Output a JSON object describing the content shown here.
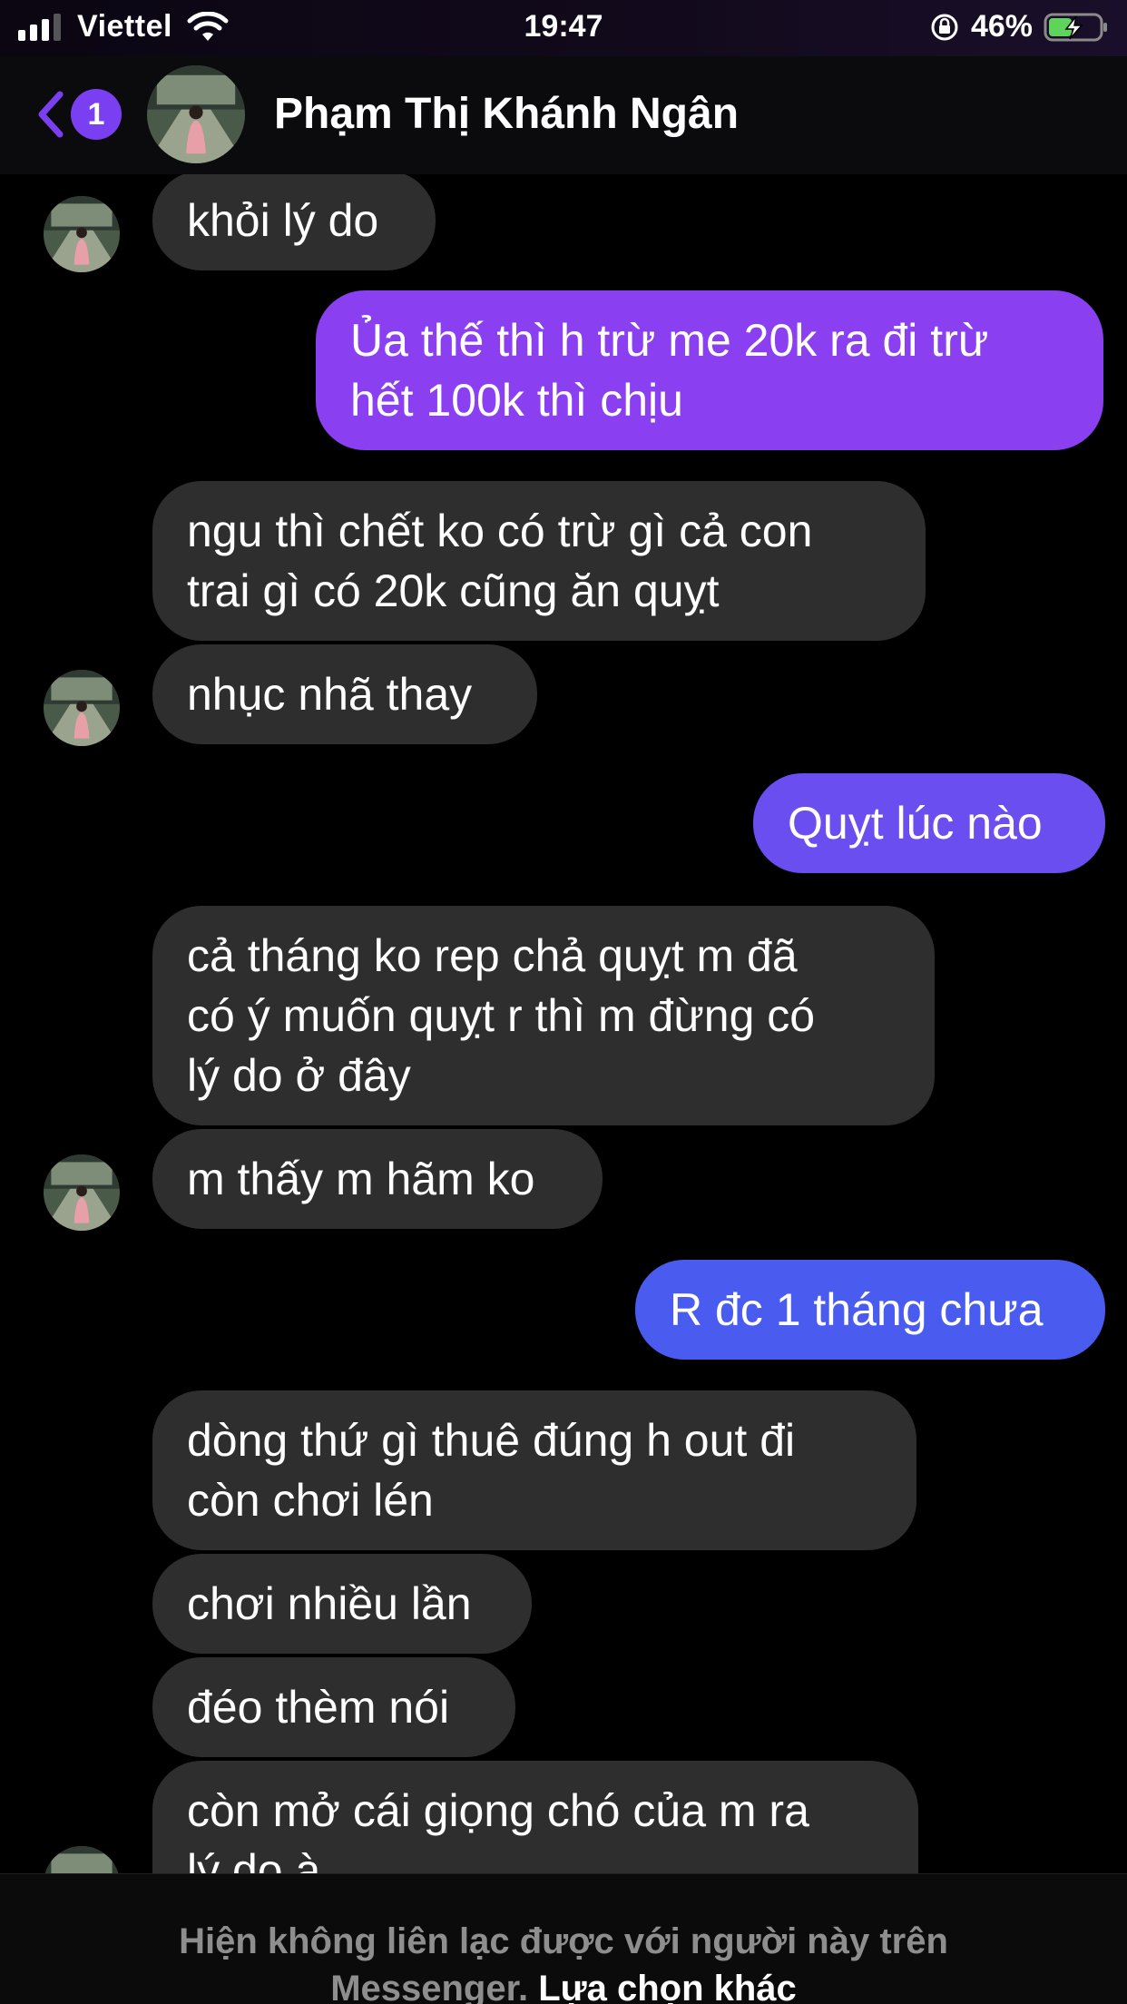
{
  "status_bar": {
    "carrier": "Viettel",
    "time": "19:47",
    "battery_percent": "46%",
    "battery_level": 0.46,
    "signal_bars": 3
  },
  "header": {
    "back_badge": "1",
    "contact_name": "Phạm Thị Khánh Ngân"
  },
  "messages": [
    {
      "from": "them",
      "lines": [
        "khỏi lý do"
      ],
      "avatar": true
    },
    {
      "from": "me",
      "lines": [
        "Ủa thế thì h trừ me 20k ra đi trừ",
        "hết 100k thì chịu"
      ]
    },
    {
      "from": "them",
      "lines": [
        "ngu thì chết ko có trừ gì cả con",
        "trai gì có 20k cũng ăn quỵt"
      ],
      "avatar": false
    },
    {
      "from": "them",
      "lines": [
        "nhục nhã thay"
      ],
      "avatar": true
    },
    {
      "from": "me",
      "lines": [
        "Quỵt lúc nào"
      ]
    },
    {
      "from": "them",
      "lines": [
        "cả tháng ko rep chả quỵt m đã",
        "có ý muốn quỵt r thì m đừng có",
        "lý do ở đây"
      ],
      "avatar": false
    },
    {
      "from": "them",
      "lines": [
        "m thấy m hãm ko"
      ],
      "avatar": true
    },
    {
      "from": "me",
      "lines": [
        "R đc 1 tháng chưa"
      ]
    },
    {
      "from": "them",
      "lines": [
        "dòng thứ gì thuê đúng h out đi",
        "còn chơi lén"
      ],
      "avatar": false
    },
    {
      "from": "them",
      "lines": [
        "chơi nhiều lần"
      ],
      "avatar": false
    },
    {
      "from": "them",
      "lines": [
        "đéo thèm nói"
      ],
      "avatar": false
    },
    {
      "from": "them",
      "lines": [
        "còn mở cái giọng chó của m ra",
        "lý do à"
      ],
      "avatar": true
    }
  ],
  "footer": {
    "notice_line1": "Hiện không liên lạc được với người này trên",
    "notice_line2": "Messenger.",
    "link": "Lựa chọn khác"
  },
  "colors": {
    "received_bubble": "#2e2e2e",
    "sent_purple": "#7b3ff2",
    "sent_blue": "#4a5cf0",
    "badge": "#7b3ff2"
  }
}
